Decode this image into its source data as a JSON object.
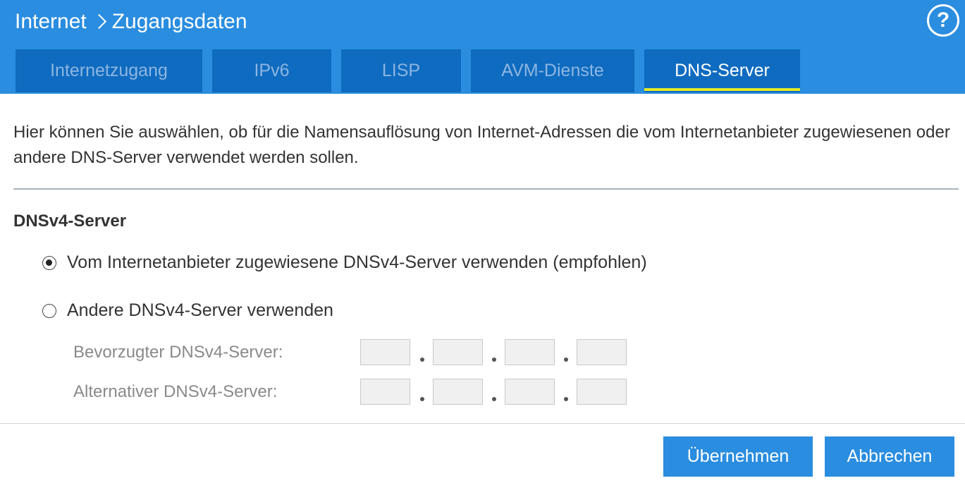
{
  "header": {
    "breadcrumb_root": "Internet",
    "breadcrumb_current": "Zugangsdaten",
    "help_glyph": "?",
    "help_icon": "question-circle-icon",
    "background": "#2a8ddf"
  },
  "tabs": [
    {
      "label": "Internetzugang",
      "active": false
    },
    {
      "label": "IPv6",
      "active": false
    },
    {
      "label": "LISP",
      "active": false
    },
    {
      "label": "AVM-Dienste",
      "active": false
    },
    {
      "label": "DNS-Server",
      "active": true
    }
  ],
  "intro_text": "Hier können Sie auswählen, ob für die Namensauflösung von Internet-Adressen die vom Internetanbieter zugewiesenen oder andere DNS-Server verwendet werden sollen.",
  "dnsv4": {
    "title": "DNSv4-Server",
    "option_provider": {
      "label": "Vom Internetanbieter zugewiesene DNSv4-Server verwenden (empfohlen)",
      "checked": true
    },
    "option_other": {
      "label": "Andere DNSv4-Server verwenden",
      "checked": false
    },
    "preferred_label": "Bevorzugter DNSv4-Server:",
    "preferred_octets": [
      "",
      "",
      "",
      ""
    ],
    "alternative_label": "Alternativer DNSv4-Server:",
    "alternative_octets": [
      "",
      "",
      "",
      ""
    ]
  },
  "buttons": {
    "apply": "Übernehmen",
    "cancel": "Abbrechen"
  },
  "colors": {
    "accent": "#2a8ddf",
    "tab_bg": "#0f6bbf",
    "active_tab_underline": "#e3e827"
  }
}
